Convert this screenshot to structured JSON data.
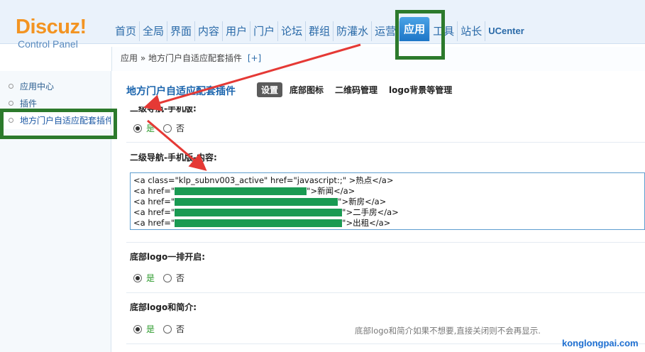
{
  "header": {
    "logo_main": "Discuz!",
    "logo_sub": "Control Panel",
    "nav": [
      {
        "label": "首页"
      },
      {
        "label": "全局"
      },
      {
        "label": "界面"
      },
      {
        "label": "内容"
      },
      {
        "label": "用户"
      },
      {
        "label": "门户"
      },
      {
        "label": "论坛"
      },
      {
        "label": "群组"
      },
      {
        "label": "防灌水"
      },
      {
        "label": "运营"
      },
      {
        "label": "应用",
        "active": true
      },
      {
        "label": "工具"
      },
      {
        "label": "站长"
      },
      {
        "label": "UCenter"
      }
    ]
  },
  "breadcrumb": {
    "path": "应用 » 地方门户自适应配套插件",
    "add": "[+]"
  },
  "sidebar": {
    "items": [
      {
        "label": "应用中心"
      },
      {
        "label": "插件"
      },
      {
        "label": "地方门户自适应配套插件",
        "active": true
      }
    ]
  },
  "main": {
    "plugin_title": "地方门户自适应配套插件",
    "tabs": [
      {
        "label": "设置",
        "active": true
      },
      {
        "label": "底部图标"
      },
      {
        "label": "二维码管理"
      },
      {
        "label": "logo背景等管理"
      }
    ],
    "section1": {
      "label": "二级导航-手机版:",
      "yes": "是",
      "no": "否",
      "value": "是"
    },
    "section2": {
      "label": "二级导航-手机版-内容:",
      "code_lines": [
        {
          "pre": "<a class=\"klp_subnv003_active\" href=\"javascript:;\" >热点</a>",
          "post": ""
        },
        {
          "pre": "<a href=\"",
          "post": "\">新闻</a>"
        },
        {
          "pre": "<a href=\"",
          "post": "\">新房</a>"
        },
        {
          "pre": "<a href=\"",
          "post": "\">二手房</a>"
        },
        {
          "pre": "<a href=\"",
          "post": "\">出租</a>"
        }
      ]
    },
    "section3": {
      "label": "底部logo一排开启:",
      "yes": "是",
      "no": "否",
      "value": "是"
    },
    "section4": {
      "label": "底部logo和简介:",
      "yes": "是",
      "no": "否",
      "value": "是",
      "hint": "底部logo和简介如果不想要,直接关闭则不会再显示."
    }
  },
  "watermark": "konglongpai.com",
  "colors": {
    "accent": "#1d76c7",
    "logo": "#f39422",
    "annotation_box": "#2c7a2c",
    "annotation_arrow": "#e53935",
    "redaction": "#1a9a52"
  }
}
